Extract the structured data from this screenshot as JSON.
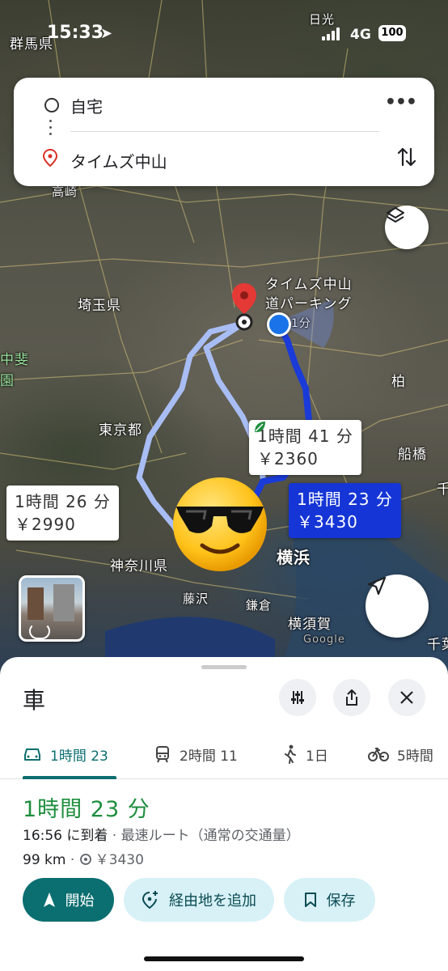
{
  "status_bar": {
    "time": "15:33",
    "network": "4G",
    "battery": "100"
  },
  "map": {
    "places": [
      "群馬県",
      "日光",
      "高崎",
      "埼玉県",
      "中斐",
      "園",
      "東京都",
      "柏",
      "船橋",
      "千",
      "神奈川県",
      "横浜",
      "藤沢",
      "鎌倉",
      "横須賀",
      "千葉",
      "Google"
    ],
    "destination_label": "タイムズ中山\n道パーキング",
    "destination_label_line1": "タイムズ中山",
    "destination_label_line2": "道パーキング",
    "walk_time": "1分",
    "routes": [
      {
        "time": "1時間 41 分",
        "price": "￥2360",
        "eco": true
      },
      {
        "time": "1時間 23 分",
        "price": "￥3430",
        "selected": true
      },
      {
        "time": "1時間 26 分",
        "price": "￥2990"
      }
    ]
  },
  "search": {
    "origin": "自宅",
    "destination": "タイムズ中山"
  },
  "sheet": {
    "title": "車",
    "tabs": [
      {
        "icon": "car-icon",
        "label": "1時間 23",
        "active": true
      },
      {
        "icon": "train-icon",
        "label": "2時間 11"
      },
      {
        "icon": "walk-icon",
        "label": "1日"
      },
      {
        "icon": "bike-icon",
        "label": "5時間"
      }
    ],
    "duration": "1時間 23 分",
    "arrival": "16:56 に到着",
    "route_note": " · 最速ルート（通常の交通量）",
    "distance": "99 km",
    "toll_sep": " · ",
    "toll": "￥3430",
    "buttons": {
      "start": "開始",
      "add_stop": "経由地を追加",
      "save": "保存"
    }
  }
}
